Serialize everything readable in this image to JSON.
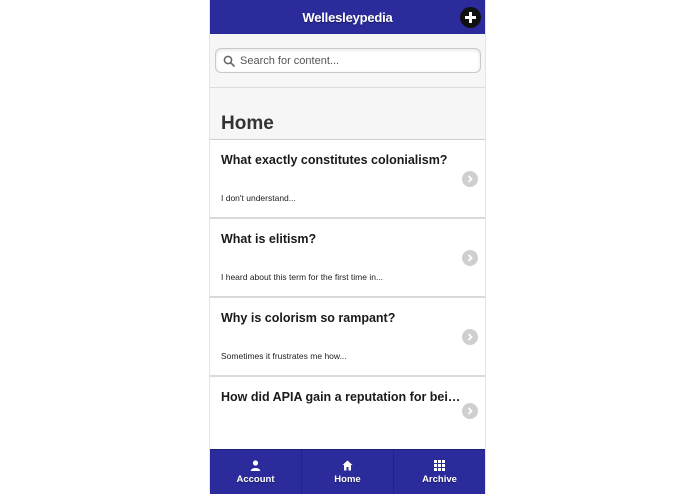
{
  "header": {
    "title": "Wellesleypedia",
    "add_icon": "plus-circle-icon"
  },
  "search": {
    "placeholder": "Search for content...",
    "value": "",
    "icon": "search-icon"
  },
  "page": {
    "title": "Home"
  },
  "items": [
    {
      "title": "What exactly constitutes colonialism?",
      "snippet": "I don't understand..."
    },
    {
      "title": "What is elitism?",
      "snippet": "I heard about this term for the first time in..."
    },
    {
      "title": "Why is colorism so rampant?",
      "snippet": "Sometimes it frustrates me how..."
    },
    {
      "title": "How did APIA gain a reputation for bein...",
      "snippet": ""
    }
  ],
  "tabs": [
    {
      "label": "Account",
      "icon": "user-icon"
    },
    {
      "label": "Home",
      "icon": "home-icon"
    },
    {
      "label": "Archive",
      "icon": "grid-icon"
    }
  ],
  "colors": {
    "brand": "#2b2b9c",
    "chevron": "#cfcfcf"
  }
}
